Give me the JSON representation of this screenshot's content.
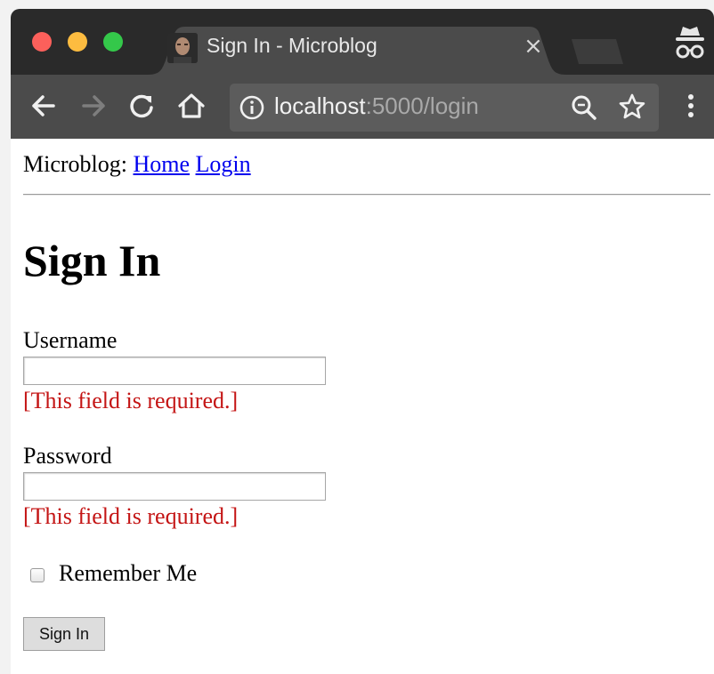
{
  "browser": {
    "tab": {
      "title": "Sign In - Microblog",
      "close_glyph": "×",
      "favicon": "profile-photo-favicon-icon"
    },
    "url": {
      "host": "localhost",
      "rest": ":5000/login"
    },
    "icons": [
      "back-arrow-icon",
      "forward-arrow-icon",
      "reload-icon",
      "home-icon",
      "info-icon",
      "zoom-icon",
      "star-icon",
      "menu-dots-icon",
      "incognito-icon"
    ]
  },
  "nav": {
    "brand": "Microblog:",
    "home_link": "Home",
    "login_link": "Login"
  },
  "form": {
    "heading": "Sign In",
    "username": {
      "label": "Username",
      "value": "",
      "error": "[This field is required.]"
    },
    "password": {
      "label": "Password",
      "value": "",
      "error": "[This field is required.]"
    },
    "remember": {
      "label": "Remember Me",
      "checked": false
    },
    "submit_label": "Sign In"
  },
  "colors": {
    "error_text": "#c41515",
    "link": "#0000ee",
    "titlebar": "#2a2a2a",
    "toolbar": "#4b4b4b"
  }
}
